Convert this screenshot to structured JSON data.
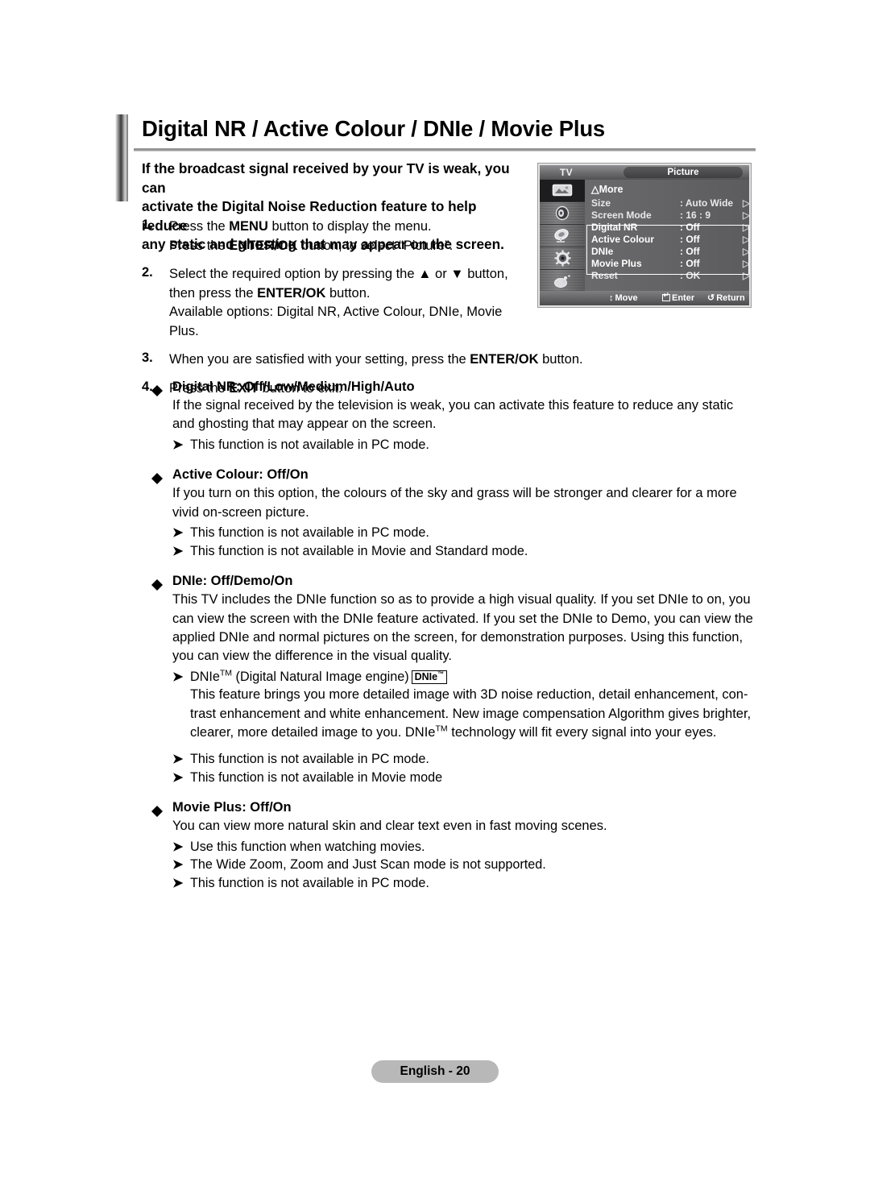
{
  "document": {
    "title": "Digital NR / Active Colour / DNIe / Movie Plus",
    "footer_label": "English - 20"
  },
  "intro": {
    "line1": "If the broadcast signal received by your TV is weak, you can",
    "line2": "activate the Digital Noise Reduction feature to help reduce",
    "line3": "any static and ghosting that may appear on the screen."
  },
  "steps": [
    {
      "number": "1.",
      "line1_pre": "Press the ",
      "line1_bold": "MENU",
      "line1_post": " button to display the menu.",
      "line2_pre": "Press the ",
      "line2_bold": "ENTER/OK",
      "line2_post": " button, to select “Picture”."
    },
    {
      "number": "2.",
      "line1_pre": "Select the required option by pressing the ▲ or ▼ button,",
      "line2_pre": "then press the ",
      "line2_bold": "ENTER/OK",
      "line2_post": " button.",
      "line3": "Available options: Digital NR, Active Colour, DNIe, Movie Plus."
    },
    {
      "number": "3.",
      "line1_pre": "When you are satisfied with your setting, press the ",
      "line1_bold": "ENTER/OK",
      "line1_post": " button."
    },
    {
      "number": "4.",
      "line1_pre": "Press the ",
      "line1_bold": "EXIT",
      "line1_post": " button to exit."
    }
  ],
  "sections": [
    {
      "heading": "Digital NR: Off/Low/Medium/High/Auto",
      "body": "If the signal received by the television is weak, you can activate this feature to reduce any static and ghosting that may appear on the screen.",
      "notes": [
        "This function is not available in PC mode."
      ]
    },
    {
      "heading": "Active Colour: Off/On",
      "body": "If you turn on this option, the colours of the sky and grass will be stronger and clearer for a more vivid on-screen picture.",
      "notes": [
        "This function is not available in PC mode.",
        "This function is not available in Movie and Standard mode."
      ]
    },
    {
      "heading": "DNIe: Off/Demo/On",
      "body": "This TV includes the DNIe function so as to provide a high visual quality. If you set DNIe to on, you can view the screen with the DNIe feature activated. If you set the DNIe to Demo, you can view the applied DNIe and normal pictures on the screen, for demonstration purposes. Using this function, you can view the difference in the visual quality.",
      "trademark_note": {
        "prefix": "DNIe",
        "sup": "TM",
        "suffix": " (Digital Natural Image engine)",
        "badge_text": "DNIe",
        "badge_sup": "™"
      },
      "trademark_body_a": "This feature brings you more detailed image with 3D noise reduction, detail enhancement, con-trast enhancement and white enhancement. New image compensation Algorithm gives brighter, clearer, more detailed image to you. DNIe",
      "trademark_body_sup": "TM",
      "trademark_body_b": " technology will fit every signal into your eyes.",
      "notes": [
        "This function is not available in PC mode.",
        "This function is not available in Movie mode"
      ]
    },
    {
      "heading": "Movie Plus: Off/On",
      "body": "You can view more natural skin and clear text even in fast moving scenes.",
      "notes": [
        "Use this function when watching movies.",
        "The Wide Zoom, Zoom and Just Scan mode is not supported.",
        "This function is not available in PC mode."
      ]
    }
  ],
  "osd": {
    "source_label": "TV",
    "menu_title": "Picture",
    "more_label": "△More",
    "sidebar_icons": [
      "picture-icon",
      "sound-icon",
      "channel-icon",
      "setup-icon",
      "input-icon"
    ],
    "rows": [
      {
        "label": "Size",
        "value": ": Auto Wide",
        "arrow": "▷"
      },
      {
        "label": "Screen Mode",
        "value": ": 16 : 9",
        "arrow": "▷"
      },
      {
        "label": "Digital NR",
        "value": ": Off",
        "arrow": "▷"
      },
      {
        "label": "Active Colour",
        "value": ": Off",
        "arrow": "▷"
      },
      {
        "label": "DNIe",
        "value": ": Off",
        "arrow": "▷"
      },
      {
        "label": "Movie Plus",
        "value": ": Off",
        "arrow": "▷"
      },
      {
        "label": "Reset",
        "value": ": OK",
        "arrow": "▷"
      }
    ],
    "footer": {
      "move": "Move",
      "move_glyph": "↕",
      "enter": "Enter",
      "return": "Return",
      "return_glyph": "↺"
    }
  }
}
